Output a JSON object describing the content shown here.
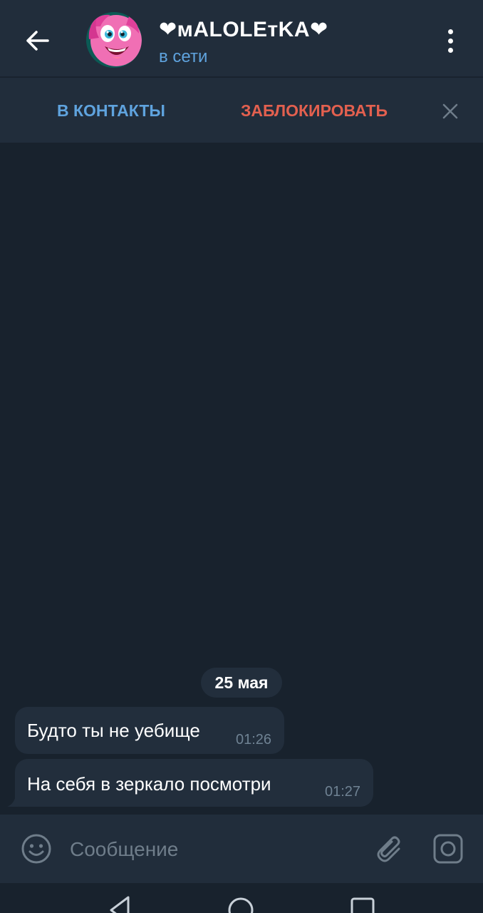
{
  "header": {
    "title": "❤мALOLEтKA❤",
    "status": "в сети",
    "back_icon": "arrow-left-icon",
    "menu_icon": "more-vertical-icon",
    "avatar": "pink-pony-avatar"
  },
  "action_bar": {
    "add_contact_label": "В КОНТАКТЫ",
    "block_label": "ЗАБЛОКИРОВАТЬ",
    "close_icon": "close-icon"
  },
  "chat": {
    "date_label": "25 мая",
    "messages": [
      {
        "text": "Будто ты не уебище",
        "time": "01:26"
      },
      {
        "text": "На себя в зеркало посмотри",
        "time": "01:27"
      }
    ]
  },
  "input_bar": {
    "placeholder": "Сообщение",
    "emoji_icon": "emoji-icon",
    "attach_icon": "paperclip-icon",
    "camera_icon": "camera-icon"
  },
  "nav_bar": {
    "back_icon": "nav-back-icon",
    "home_icon": "nav-home-icon",
    "recents_icon": "nav-recents-icon"
  },
  "colors": {
    "header_bg": "#212d3b",
    "chat_bg": "#18222d",
    "bubble_bg": "#222e3c",
    "accent_blue": "#5fa3de",
    "accent_red": "#e3604f"
  }
}
